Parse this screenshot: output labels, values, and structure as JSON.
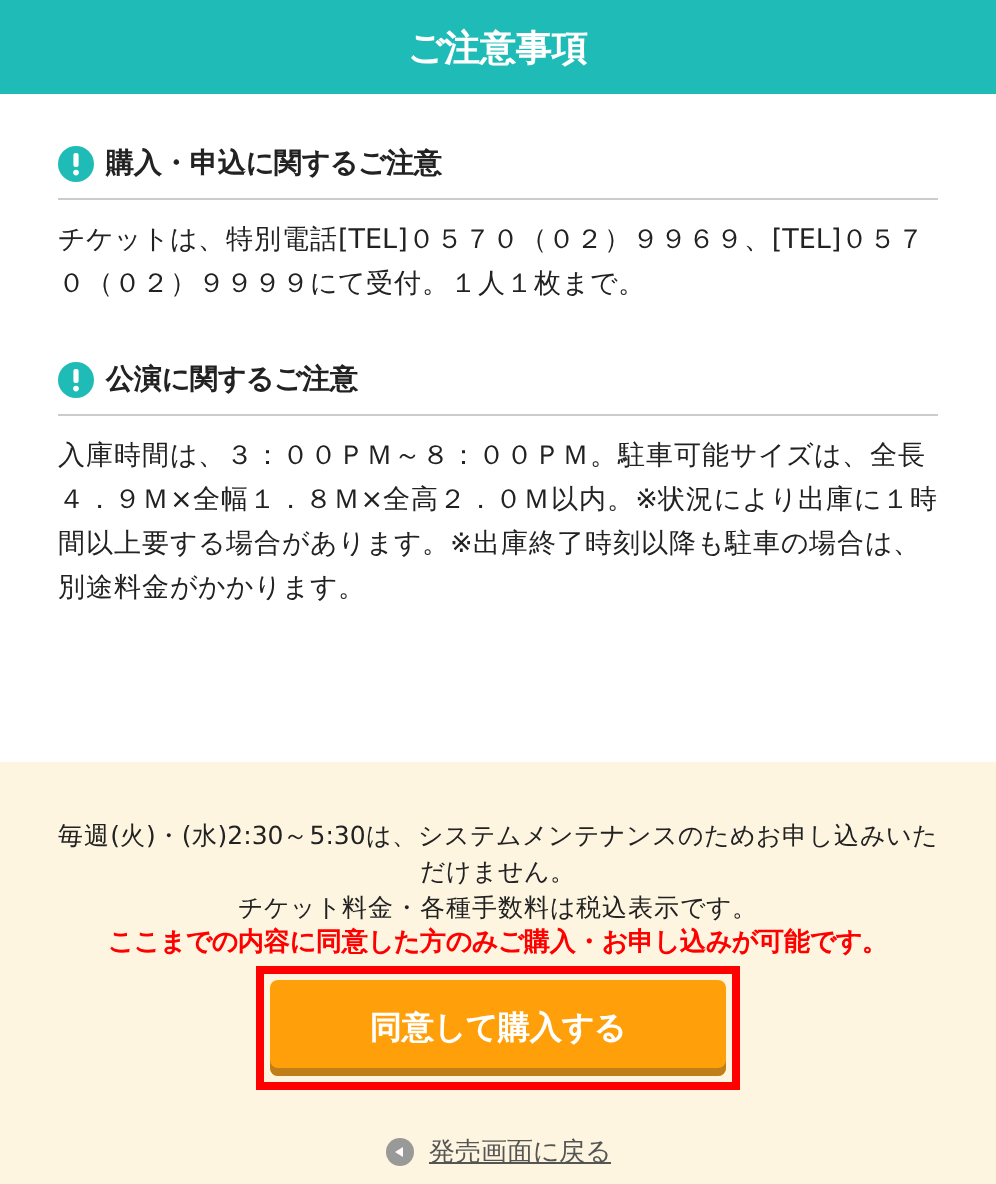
{
  "header": {
    "title": "ご注意事項"
  },
  "sections": [
    {
      "title": "購入・申込に関するご注意",
      "body": "チケットは、特別電話[TEL]０５７０（０２）９９６９、[TEL]０５７０（０２）９９９９にて受付。１人１枚まで。"
    },
    {
      "title": "公演に関するご注意",
      "body": "入庫時間は、３：００ＰＭ～８：００ＰＭ。駐車可能サイズは、全長４．９Ｍ×全幅１．８Ｍ×全高２．０Ｍ以内。※状況により出庫に１時間以上要する場合があります。※出庫終了時刻以降も駐車の場合は、別途料金がかかります。"
    }
  ],
  "footer": {
    "notes": [
      {
        "text": "毎週(火)・(水)2:30～5:30は、システムメンテナンスのためお申し込みいただけません。",
        "kind": "plain"
      },
      {
        "text": "チケット料金・各種手数料は税込表示です。",
        "kind": "plain"
      },
      {
        "text": "ここまでの内容に同意した方のみご購入・お申し込みが可能です。",
        "kind": "warning"
      }
    ],
    "button": {
      "label": "同意して購入する",
      "highlighted": true
    },
    "back_link": "発売画面に戻る"
  }
}
